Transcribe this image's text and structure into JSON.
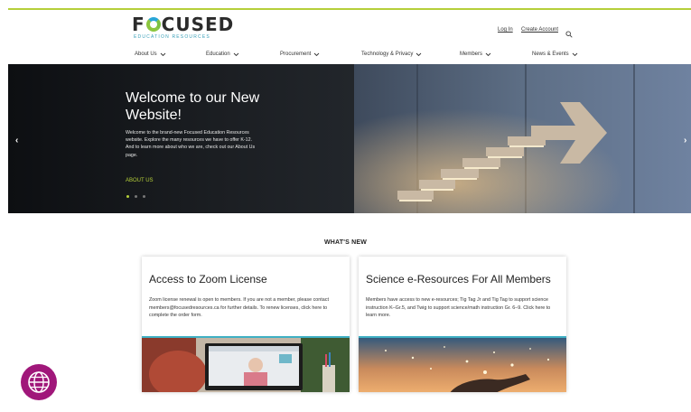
{
  "brand": {
    "logo_word_left": "F",
    "logo_word_right": "CUSED",
    "logo_sub": "EDUCATION RESOURCES"
  },
  "header": {
    "login": "Log In",
    "create_account": "Create Account",
    "search_icon": "search-icon"
  },
  "nav": {
    "items": [
      {
        "label": "About Us"
      },
      {
        "label": "Education"
      },
      {
        "label": "Procurement"
      },
      {
        "label": "Technology & Privacy"
      },
      {
        "label": "Members"
      },
      {
        "label": "News & Events"
      }
    ]
  },
  "hero": {
    "title": "Welcome to our New Website!",
    "body": "Welcome to the brand-new Focused Education Resources website. Explore the many resources we have to offer K-12. And to learn more about who we are, check out our About Us page.",
    "link": "ABOUT US",
    "prev": "‹",
    "next": "›",
    "slide_count": 3,
    "active_slide": 1
  },
  "whats_new": {
    "title": "WHAT'S NEW",
    "cards": [
      {
        "title": "Access to Zoom License",
        "body": "Zoom license renewal is open to members. If you are not a member, please contact members@focusedresources.ca for further details. To renew licenses, click here to complete the order form."
      },
      {
        "title": "Science e-Resources For All Members",
        "body": "Members have access to new e-resources; Tig Tag Jr and Tig Tag to support science instruction K–Gr.5, and Twig to support science/math instruction Gr. 6–9. Click here to learn more."
      }
    ]
  },
  "colors": {
    "accent": "#b5cf3a",
    "globe": "#a0177a",
    "card_rule": "#3fb0c4"
  },
  "icons": [
    "search-icon",
    "chevron-down-icon",
    "globe-icon",
    "chevron-left-icon",
    "chevron-right-icon"
  ]
}
